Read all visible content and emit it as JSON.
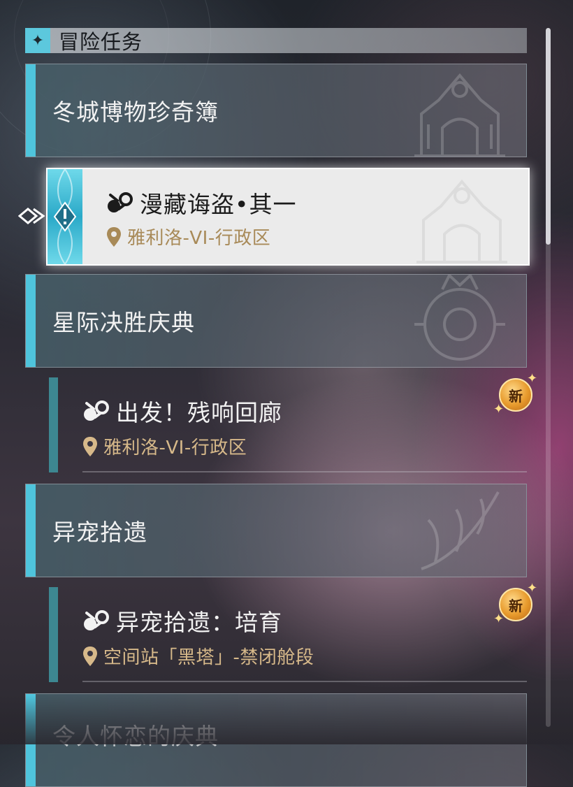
{
  "header": {
    "title": "冒险任务",
    "icon": "sparkle-icon"
  },
  "categories": [
    {
      "title": "冬城博物珍奇簿"
    },
    {
      "title": "星际决胜庆典"
    },
    {
      "title": "异宠拾遗"
    },
    {
      "title": "令人怀恋的庆典"
    }
  ],
  "quests": [
    {
      "title": "漫藏诲盗•其一",
      "location": "雅利洛-VI-行政区",
      "selected": true,
      "is_new": false
    },
    {
      "title": "出发！残响回廊",
      "location": "雅利洛-VI-行政区",
      "selected": false,
      "is_new": true
    },
    {
      "title": "异宠拾遗：培育",
      "location": "空间站「黑塔」-禁闭舱段",
      "selected": false,
      "is_new": true
    }
  ],
  "badge": {
    "label": "新"
  },
  "colors": {
    "accent": "#4fc4dc",
    "location_text": "#d7b98a",
    "badge_gold": "#e79a2c"
  },
  "scroll": {
    "position_fraction": 0.0,
    "visible_fraction": 0.31
  }
}
